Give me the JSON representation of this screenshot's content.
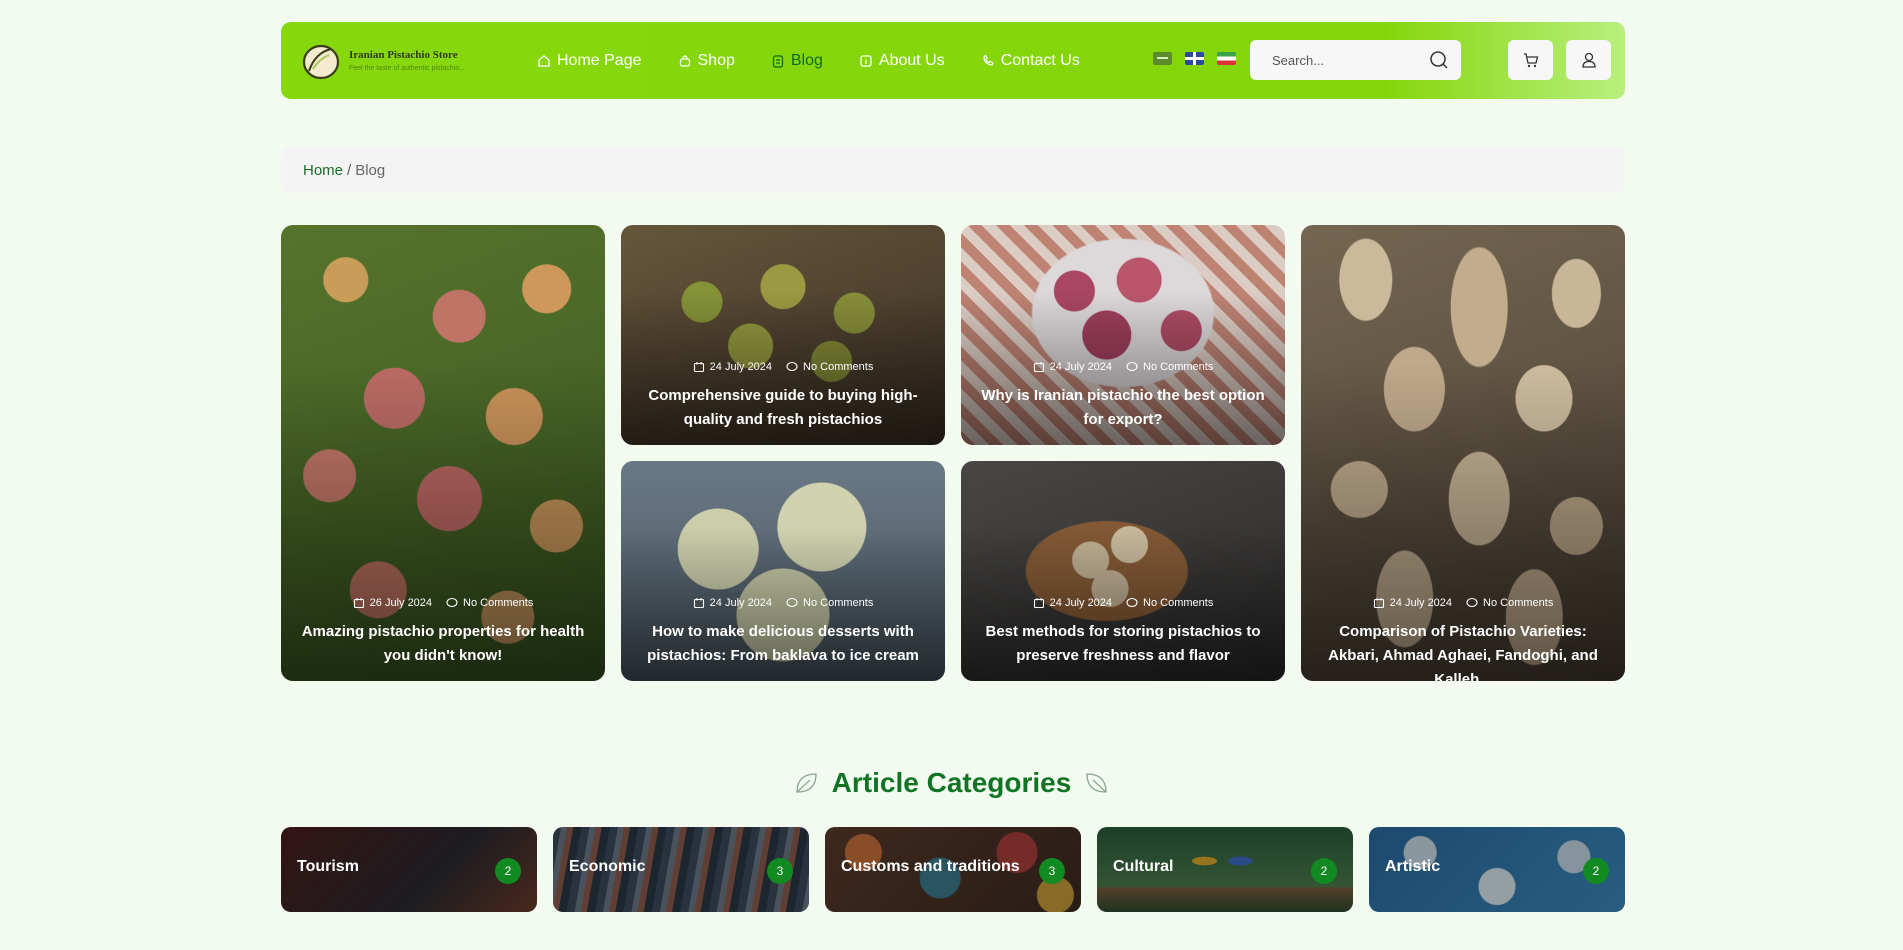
{
  "header": {
    "logo_title": "Iranian Pistachio Store",
    "logo_subtitle": "Feel the taste of authentic pistachio...",
    "nav": [
      {
        "label": "Home Page",
        "icon": "home-icon"
      },
      {
        "label": "Shop",
        "icon": "shop-bag-icon"
      },
      {
        "label": "Blog",
        "icon": "blog-icon",
        "active": true
      },
      {
        "label": "About Us",
        "icon": "info-icon"
      },
      {
        "label": "Contact Us",
        "icon": "phone-icon"
      }
    ],
    "flags": [
      "saudi-flag",
      "uk-flag",
      "iran-flag"
    ],
    "search_placeholder": "Search...",
    "accent": "#86d80c"
  },
  "breadcrumb": {
    "home": "Home",
    "separator": "/",
    "current": "Blog"
  },
  "posts": [
    {
      "date": "26 July 2024",
      "comments": "No Comments",
      "title": "Amazing pistachio properties for health you didn't know!"
    },
    {
      "date": "24 July 2024",
      "comments": "No Comments",
      "title": "Comprehensive guide to buying high-quality and fresh pistachios"
    },
    {
      "date": "24 July 2024",
      "comments": "No Comments",
      "title": "Why is Iranian pistachio the best option for export?"
    },
    {
      "date": "24 July 2024",
      "comments": "No Comments",
      "title": "How to make delicious desserts with pistachios: From baklava to ice cream"
    },
    {
      "date": "24 July 2024",
      "comments": "No Comments",
      "title": "Best methods for storing pistachios to preserve freshness and flavor"
    },
    {
      "date": "24 July 2024",
      "comments": "No Comments",
      "title": "Comparison of Pistachio Varieties: Akbari, Ahmad Aghaei, Fandoghi, and Kalleh..."
    }
  ],
  "categories_heading": "Article Categories",
  "categories": [
    {
      "name": "Tourism",
      "count": "2"
    },
    {
      "name": "Economic",
      "count": "3"
    },
    {
      "name": "Customs and traditions",
      "count": "3"
    },
    {
      "name": "Cultural",
      "count": "2"
    },
    {
      "name": "Artistic",
      "count": "2"
    }
  ]
}
